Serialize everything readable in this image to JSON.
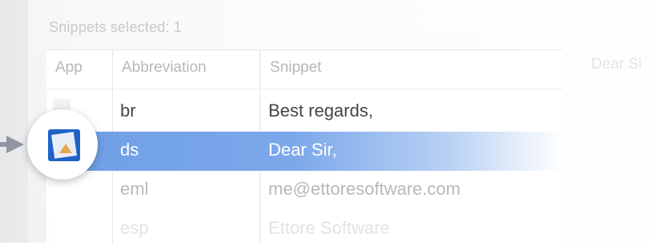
{
  "status": {
    "text": "Snippets selected: 1"
  },
  "ghost_preview": {
    "text": "Dear Si"
  },
  "table": {
    "headers": [
      "App",
      "Abbreviation",
      "Snippet"
    ],
    "rows": [
      {
        "abbr": "br",
        "snippet": "Best regards,"
      },
      {
        "abbr": "ds",
        "snippet": "Dear Sir,"
      },
      {
        "abbr": "eml",
        "snippet": "me@ettoresoftware.com"
      },
      {
        "abbr": "esp",
        "snippet": "Ettore Software"
      }
    ],
    "selected_index": 1
  },
  "colors": {
    "selection": "#6e9ee6",
    "icon_blue": "#1f63c8"
  }
}
